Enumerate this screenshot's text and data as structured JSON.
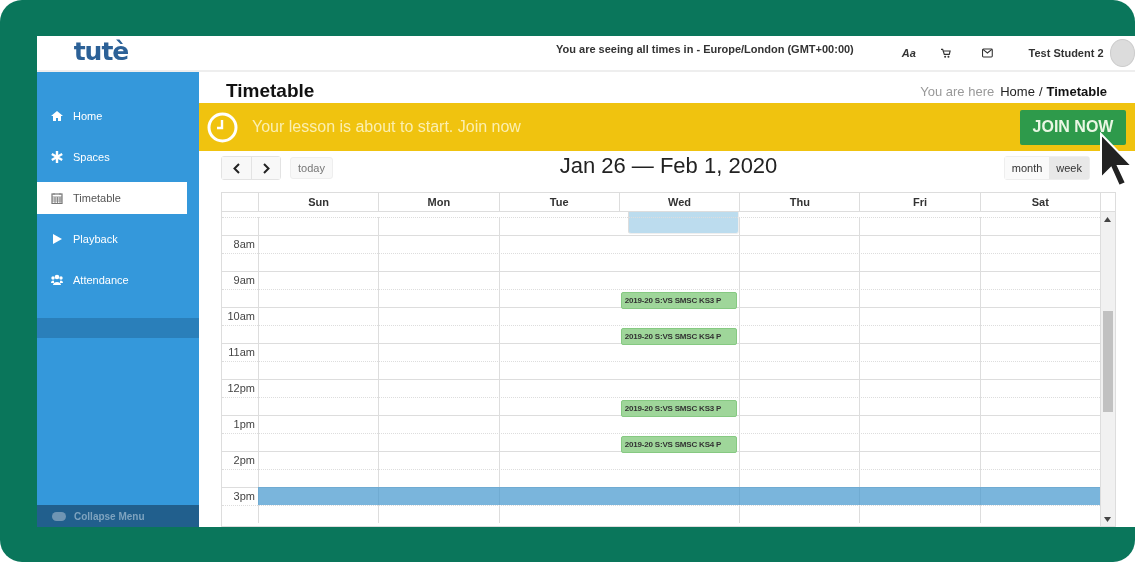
{
  "header": {
    "logo": "tutè",
    "timezone": "You are seeing all times in - Europe/London (GMT+00:00)",
    "font_button": "Aa",
    "user_name": "Test Student 2"
  },
  "sidebar": {
    "items": [
      {
        "label": "Home",
        "selected": false
      },
      {
        "label": "Spaces",
        "selected": false
      },
      {
        "label": "Timetable",
        "selected": true
      },
      {
        "label": "Playback",
        "selected": false
      },
      {
        "label": "Attendance",
        "selected": false
      }
    ],
    "collapse_label": "Collapse Menu"
  },
  "page": {
    "title": "Timetable",
    "breadcrumb_lead": "You are here",
    "breadcrumb_home": "Home",
    "breadcrumb_separator": "/",
    "breadcrumb_current": "Timetable"
  },
  "banner": {
    "message": "Your lesson is about to start. Join now",
    "button": "JOIN NOW"
  },
  "calendar": {
    "today_button": "today",
    "range_title": "Jan 26 — Feb 1, 2020",
    "views": [
      {
        "label": "month",
        "selected": false
      },
      {
        "label": "week",
        "selected": true
      }
    ],
    "days": [
      {
        "label": "Sun",
        "today": false
      },
      {
        "label": "Mon",
        "today": false
      },
      {
        "label": "Tue",
        "today": false
      },
      {
        "label": "Wed",
        "today": true
      },
      {
        "label": "Thu",
        "today": false
      },
      {
        "label": "Fri",
        "today": false
      },
      {
        "label": "Sat",
        "today": false
      }
    ],
    "slots": [
      {
        "current": false
      },
      {
        "label": "8am",
        "current": false
      },
      {
        "current": false
      },
      {
        "label": "9am",
        "current": false
      },
      {
        "current": false,
        "events": [
          {
            "title": "2019-20 S:VS SMSC KS3 P"
          }
        ]
      },
      {
        "label": "10am",
        "current": false
      },
      {
        "current": false,
        "events": [
          {
            "title": "2019-20 S:VS SMSC KS4 P"
          }
        ]
      },
      {
        "label": "11am",
        "current": false
      },
      {
        "current": false
      },
      {
        "label": "12pm",
        "current": false
      },
      {
        "current": false,
        "events": [
          {
            "title": "2019-20 S:VS SMSC KS3 P"
          }
        ]
      },
      {
        "label": "1pm",
        "current": false
      },
      {
        "current": false,
        "events": [
          {
            "title": "2019-20 S:VS SMSC KS4 P"
          }
        ]
      },
      {
        "label": "2pm",
        "current": false
      },
      {
        "current": false
      },
      {
        "label": "3pm",
        "current": true
      },
      {
        "current": false
      }
    ]
  }
}
